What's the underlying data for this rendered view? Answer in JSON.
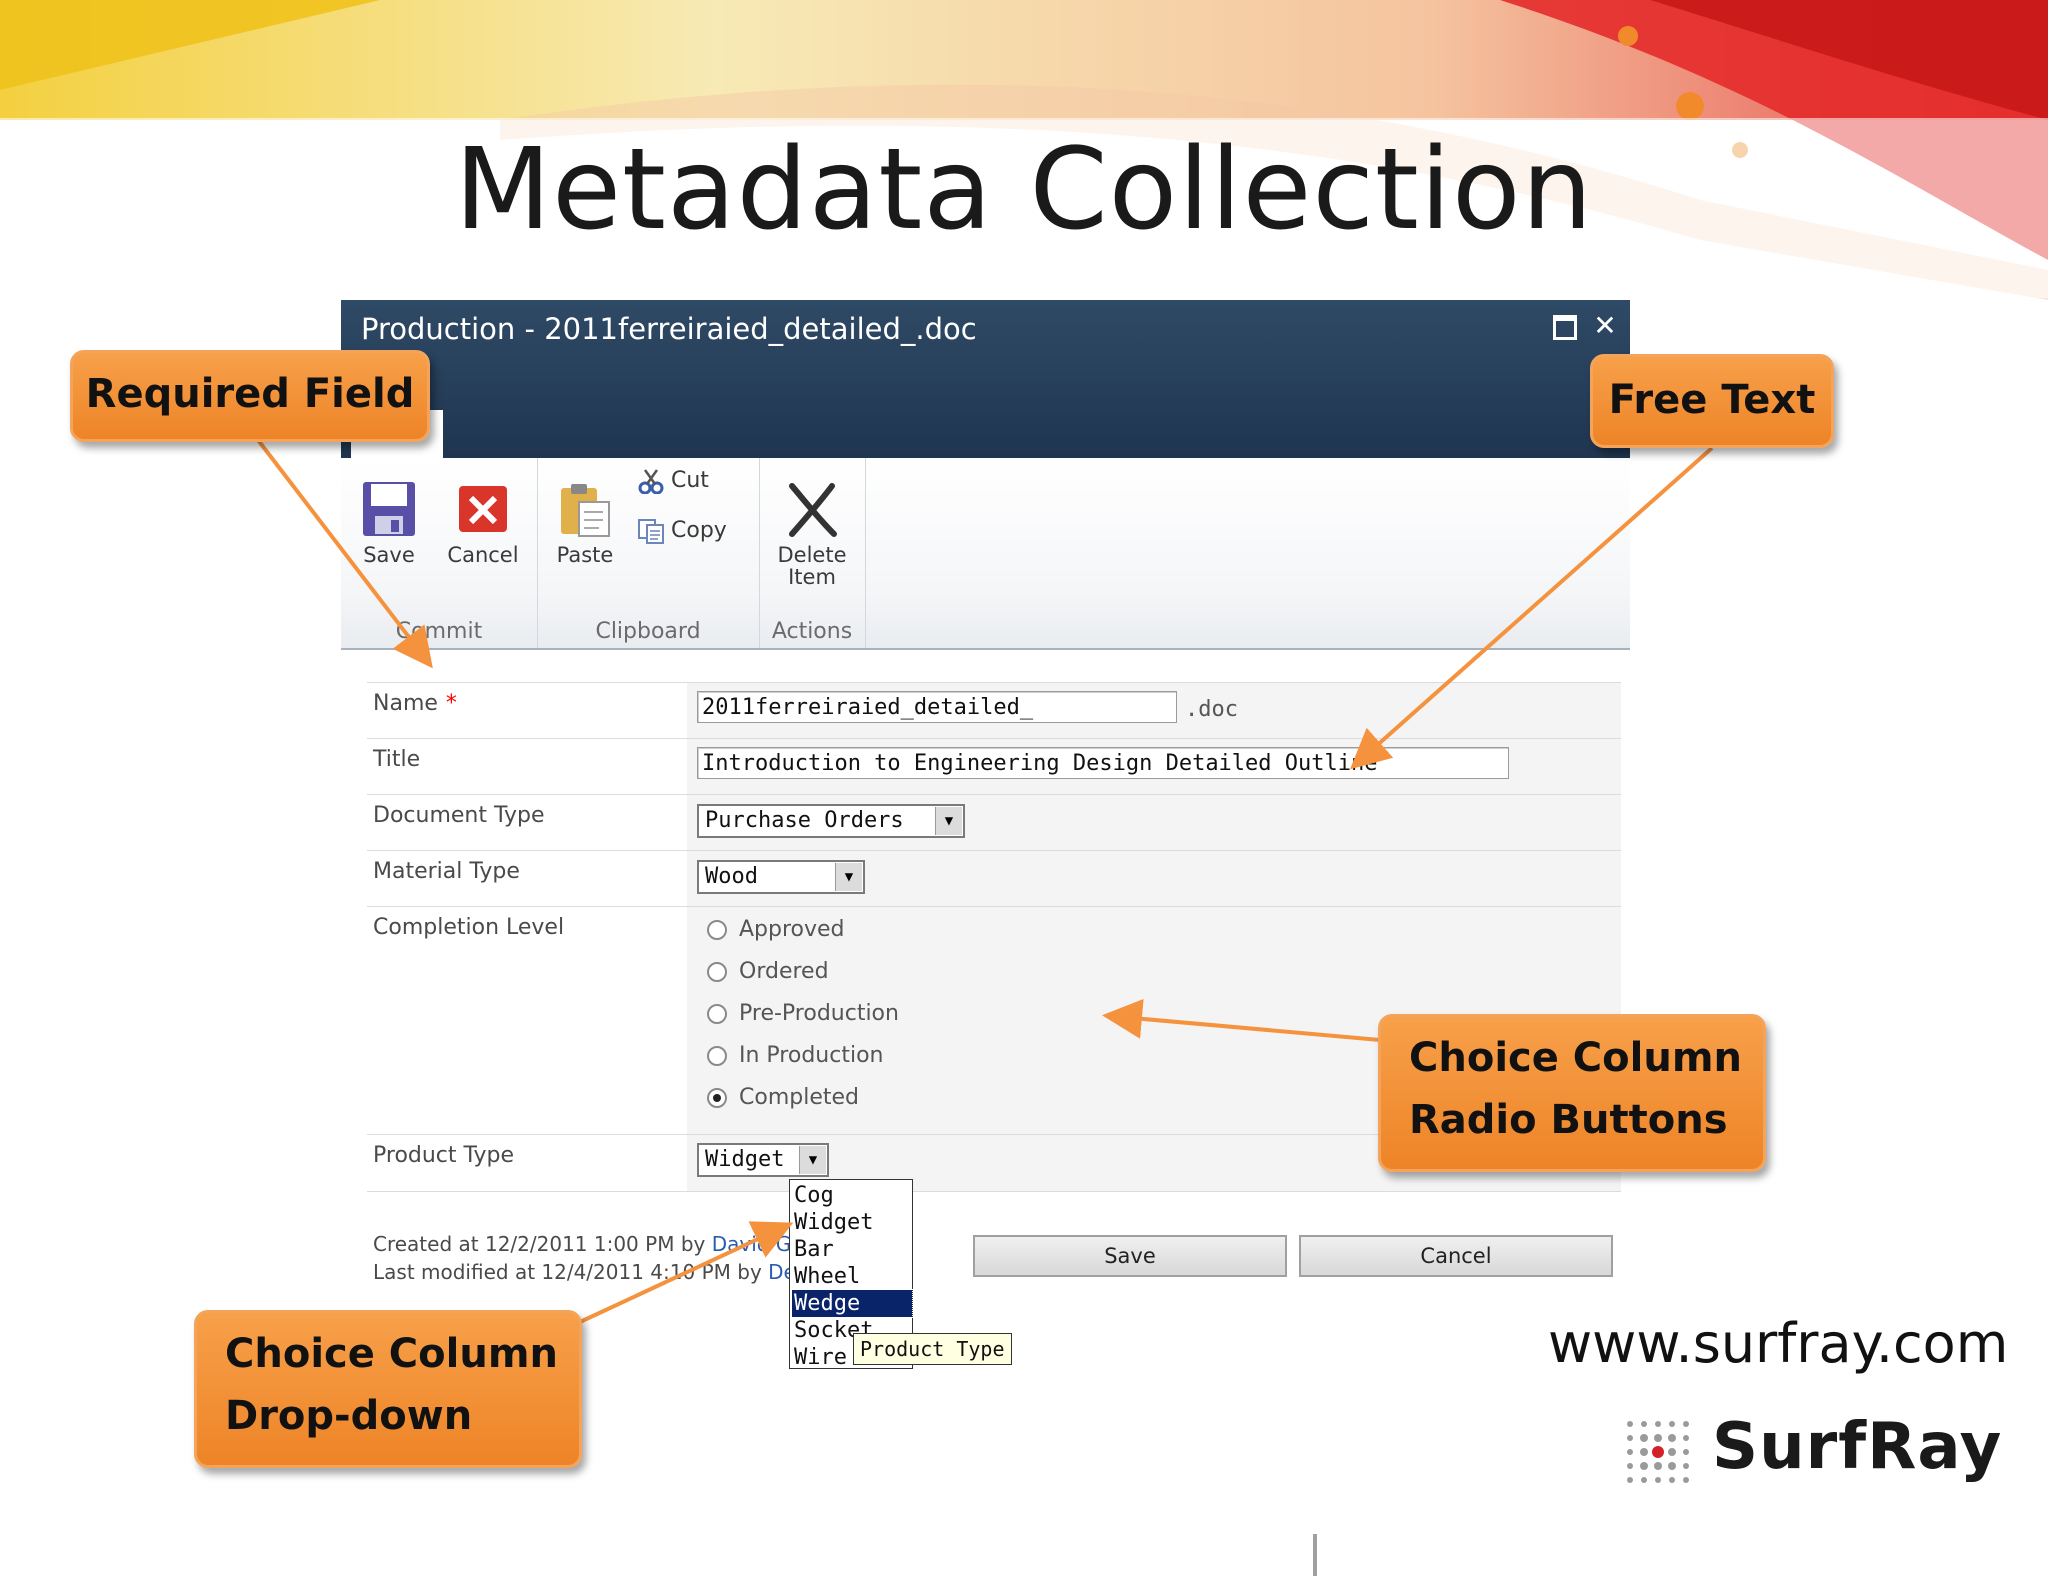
{
  "slide": {
    "title": "Metadata Collection",
    "website": "www.surfray.com",
    "logo_text": "SurfRay"
  },
  "dialog": {
    "title": "Production - 2011ferreiraied_detailed_.doc",
    "ribbon": {
      "groups": {
        "commit": "Commit",
        "clipboard": "Clipboard",
        "actions": "Actions"
      },
      "save_label": "Save",
      "cancel_label": "Cancel",
      "paste_label": "Paste",
      "cut_label": "Cut",
      "copy_label": "Copy",
      "delete_label_line1": "Delete",
      "delete_label_line2": "Item"
    },
    "form": {
      "name_label": "Name",
      "required_marker": "*",
      "name_value": "2011ferreiraied_detailed_",
      "name_suffix": ".doc",
      "title_label": "Title",
      "title_value": "Introduction to Engineering Design Detailed Outline",
      "document_type_label": "Document Type",
      "document_type_value": "Purchase Orders",
      "material_type_label": "Material Type",
      "material_type_value": "Wood",
      "completion_level_label": "Completion Level",
      "completion_options": [
        "Approved",
        "Ordered",
        "Pre-Production",
        "In Production",
        "Completed"
      ],
      "completion_selected": "Completed",
      "product_type_label": "Product Type",
      "product_type_value": "Widget",
      "product_type_options": [
        "Cog",
        "Widget",
        "Bar",
        "Wheel",
        "Wedge",
        "Socket",
        "Wire"
      ],
      "product_type_highlighted": "Wedge",
      "tooltip": "Product Type",
      "created_text": "Created at 12/2/2011 1:00 PM by",
      "created_by": "David G",
      "modified_text": "Last modified at 12/4/2011 4:10 PM by",
      "modified_by": "De",
      "save_button": "Save",
      "cancel_button": "Cancel"
    }
  },
  "callouts": {
    "required_field": "Required Field",
    "free_text": "Free Text",
    "radio_line1": "Choice Column",
    "radio_line2": "Radio Buttons",
    "dropdown_line1": "Choice Column",
    "dropdown_line2": "Drop-down"
  },
  "colors": {
    "callout_orange": "#ee8427",
    "dialog_header": "#243d58",
    "arrow_orange": "#f5923e"
  }
}
